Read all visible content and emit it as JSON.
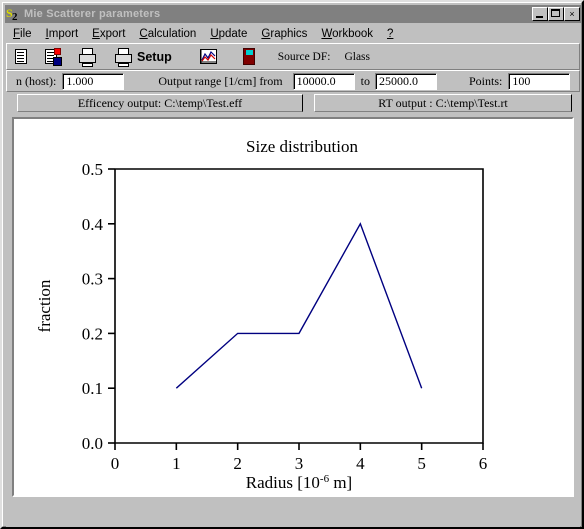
{
  "window": {
    "title": "Mie Scatterer parameters",
    "icon": "mie-app-icon",
    "controls": {
      "minimize": "minimize-button",
      "maximize": "maximize-button",
      "close": "×"
    }
  },
  "menu": {
    "items": [
      {
        "label": "File",
        "accel": "F"
      },
      {
        "label": "Import",
        "accel": "I"
      },
      {
        "label": "Export",
        "accel": "E"
      },
      {
        "label": "Calculation",
        "accel": "C"
      },
      {
        "label": "Update",
        "accel": "U"
      },
      {
        "label": "Graphics",
        "accel": "G"
      },
      {
        "label": "Workbook",
        "accel": "W"
      },
      {
        "label": "?",
        "accel": "?"
      }
    ]
  },
  "toolbar": {
    "icons": [
      {
        "name": "new-document-icon"
      },
      {
        "name": "save-document-icon"
      },
      {
        "name": "print-icon"
      },
      {
        "name": "print-setup-icon"
      },
      {
        "name": "plot-chart-icon"
      },
      {
        "name": "exit-door-icon"
      }
    ],
    "setup_label": "Setup",
    "source_df_label": "Source DF:",
    "source_df_value": "Glass"
  },
  "params": {
    "n_host_label": "n (host):",
    "n_host_value": "1.000",
    "output_range_label": "Output range [1/cm] from",
    "range_from_value": "10000.0",
    "to_label": "to",
    "range_to_value": "25000.0",
    "points_label": "Points:",
    "points_value": "100"
  },
  "outputs": {
    "efficiency": "Efficency output: C:\\temp\\Test.eff",
    "rt": "RT output : C:\\temp\\Test.rt"
  },
  "chart_data": {
    "type": "line",
    "title": "Size distribution",
    "xlabel_main": "Radius [10",
    "xlabel_sup": "-6",
    "xlabel_tail": " m]",
    "ylabel": "fraction",
    "x": [
      1,
      2,
      3,
      4,
      5
    ],
    "values": [
      0.1,
      0.2,
      0.2,
      0.4,
      0.1
    ],
    "series": [
      {
        "name": "Size distribution",
        "values": [
          0.1,
          0.2,
          0.2,
          0.4,
          0.1
        ]
      }
    ],
    "xlim": [
      0,
      6
    ],
    "ylim": [
      0.0,
      0.5
    ],
    "xticks": [
      "0",
      "1",
      "2",
      "3",
      "4",
      "5",
      "6"
    ],
    "yticks": [
      "0.0",
      "0.1",
      "0.2",
      "0.3",
      "0.4",
      "0.5"
    ],
    "grid": false,
    "legend": "none",
    "line_color": "#000080",
    "axis_color": "#000000",
    "background": "#ffffff"
  }
}
